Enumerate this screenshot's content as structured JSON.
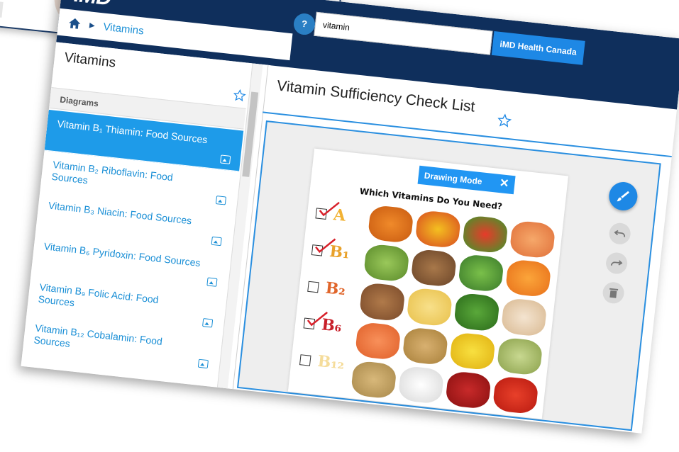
{
  "app": {
    "logo": "iMD",
    "breadcrumb": {
      "current": "Vitamins"
    },
    "help_label": "?",
    "search": {
      "value": "vitamin"
    },
    "org_badge": "iMD Health Canada"
  },
  "sidebar": {
    "title": "Vitamins",
    "section_label": "Diagrams",
    "items": [
      {
        "label": "Vitamin B₁ Thiamin: Food Sources",
        "active": true
      },
      {
        "label": "Vitamin B₂ Riboflavin: Food Sources",
        "active": false
      },
      {
        "label": "Vitamin B₃ Niacin: Food Sources",
        "active": false
      },
      {
        "label": "Vitamin B₆ Pyridoxin: Food Sources",
        "active": false
      },
      {
        "label": "Vitamin B₉ Folic Acid: Food Sources",
        "active": false
      },
      {
        "label": "Vitamin B₁₂ Cobalamin: Food Sources",
        "active": false
      }
    ]
  },
  "content": {
    "title": "Vitamin Sufficiency Check List",
    "drawing_mode_label": "Drawing Mode",
    "diagram_heading": "Which Vitamins Do You Need?",
    "vitamins": [
      {
        "label": "A",
        "checked": true,
        "color": "#f2b233"
      },
      {
        "label": "B₁",
        "checked": true,
        "color": "#e8a12a"
      },
      {
        "label": "B₂",
        "checked": false,
        "color": "#e0652a"
      },
      {
        "label": "B₆",
        "checked": true,
        "color": "#c8202a"
      },
      {
        "label": "B₁₂",
        "checked": false,
        "color": "#f5dc9a"
      }
    ]
  },
  "colors": {
    "header_bg": "#0f2f5c",
    "accent": "#1e88e5",
    "active_item": "#1e9be9",
    "link": "#1a8fd6",
    "check_mark": "#d8202a"
  }
}
